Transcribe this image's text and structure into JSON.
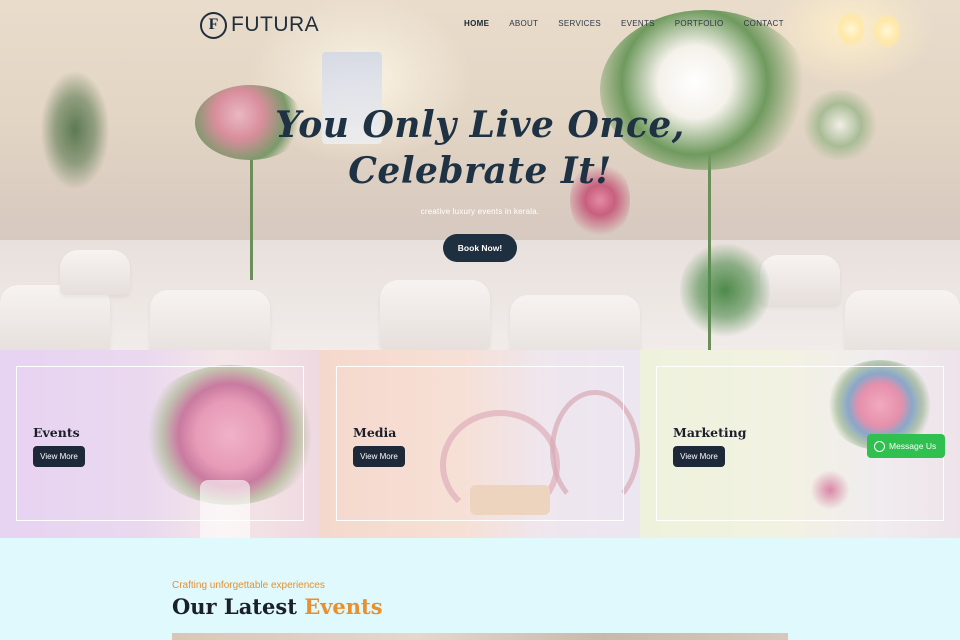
{
  "brand": {
    "logo_letter": "F",
    "name": "FUTURA"
  },
  "nav": {
    "items": [
      {
        "label": "HOME",
        "active": true
      },
      {
        "label": "ABOUT",
        "active": false
      },
      {
        "label": "SERVICES",
        "active": false
      },
      {
        "label": "EVENTS",
        "active": false
      },
      {
        "label": "PORTFOLIO",
        "active": false
      },
      {
        "label": "CONTACT",
        "active": false
      }
    ]
  },
  "hero": {
    "headline_line1": "You Only Live Once,",
    "headline_line2": "Celebrate It!",
    "subtitle": "creative luxury events in kerala.",
    "cta_label": "Book Now!"
  },
  "services": [
    {
      "title": "Events",
      "button_label": "View More"
    },
    {
      "title": "Media",
      "button_label": "View More"
    },
    {
      "title": "Marketing",
      "button_label": "View More"
    }
  ],
  "whatsapp": {
    "label": "Message Us"
  },
  "latest_events": {
    "kicker": "Crafting unforgettable experiences",
    "title_main": "Our Latest",
    "title_accent": "Events"
  },
  "colors": {
    "navy": "#1e2f40",
    "accent_orange": "#e8902e",
    "whatsapp_green": "#2fc050",
    "section_bg": "#dff9fc"
  },
  "icons": [
    "logo-f-icon",
    "whatsapp-icon"
  ]
}
